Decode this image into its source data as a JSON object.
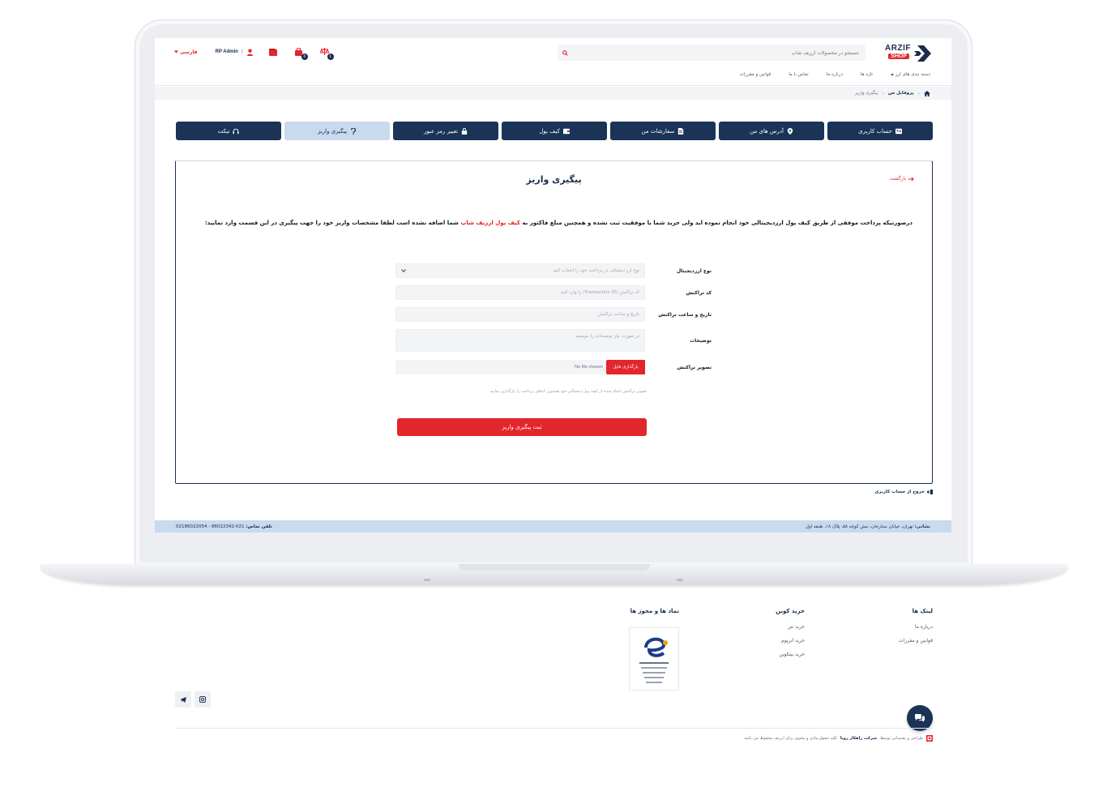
{
  "brand": {
    "logo_text": "ARZIF",
    "logo_sub": "SHOP",
    "accent": "#e3262c",
    "navy": "#1a3357",
    "light_blue": "#c9d9ee"
  },
  "header": {
    "search_placeholder": "جستجو در محصولات ارزیف شاپ",
    "language": "فارسی",
    "user_name": "RP Admin",
    "cart_badge": "3",
    "compare_badge": "1"
  },
  "nav": {
    "items": [
      "دسته بندی های ارز",
      "تازه ها",
      "درباره ما",
      "تماس با ما",
      "قوانین و مقررات"
    ]
  },
  "breadcrumb": {
    "profile": "پروفایل من",
    "current": "پیگیری واریز"
  },
  "tabs": [
    {
      "label": "حساب کاربری",
      "icon": "id-card-icon"
    },
    {
      "label": "آدرس های من",
      "icon": "map-pin-icon"
    },
    {
      "label": "سفارشات من",
      "icon": "file-icon"
    },
    {
      "label": "کیف پول",
      "icon": "wallet-icon"
    },
    {
      "label": "تغییر رمز عبور",
      "icon": "lock-icon"
    },
    {
      "label": "پیگیری واریز",
      "icon": "question-icon"
    },
    {
      "label": "تیکت",
      "icon": "headset-icon"
    }
  ],
  "panel": {
    "title": "پیگیری واریز",
    "back": "بازگشت",
    "intro_before": "درصورتیکه پرداخت موفقی از طریق کیف پول ارزدیجیتالی خود انجام نموده اید ولی خرید شما با موفقیت ثبت نشده و همچنین مبلغ فاکتور به",
    "intro_highlight": "کیف پول ارزیف شاپ",
    "intro_after": "شما اضافه نشده است لطفا مشخصات واریز خود را جهت پیگیری در این قسمت وارد نمایید:"
  },
  "form": {
    "currency_label": "نوع ارزدیجیتال",
    "currency_value": "نوع ارز دیجیتالی در پرداخت خود را انتخاب کنید",
    "txid_label": "کد تراکنش",
    "txid_placeholder": "کد تراکنش (Transaction ID) را وارد کنید",
    "datetime_label": "تاریخ و ساعت تراکنش",
    "datetime_placeholder": "تاریخ و ساعت تراکنش",
    "desc_label": "توضیحات",
    "desc_placeholder": "در صورت نیاز توضیحات را بنویسید",
    "image_label": "تصویر تراکنش",
    "upload_button": "بارگذاری فایل",
    "file_status": "No file chosen",
    "file_hint": "تصویر تراکنش انجام شده از کیف پول دیجیتالی خود همچون کدهای پرداخت را بارگذاری نمایید",
    "submit": "ثبت پیگیری واریز"
  },
  "logout": "خروج از حساب کاربری",
  "screen_footer": {
    "address_label": "نشانی:",
    "address": "تهران، خیابان ستارخان، نبش کوچه ۵۸، پلاک ۱۸، طبقه اول",
    "phone_label": "تلفن تماس:",
    "phone": "021-86022342 - 02186022054"
  },
  "footer": {
    "links_title": "لینک ها",
    "links": [
      "درباره ما",
      "قوانین و مقررات"
    ],
    "buy_title": "خرید کوین",
    "buy": [
      "خرید تتر",
      "خرید اتریوم",
      "خرید بیتکوین"
    ],
    "trust_title": "نماد ها و مجوز ها",
    "copyright_pre": "طراحی و پشتیبانی توسط",
    "company": "شرکت راهکار رویا",
    "copyright_post": "کلیه حقوق مادی و معنوی برای ارزیف محفوظ می باشد"
  }
}
